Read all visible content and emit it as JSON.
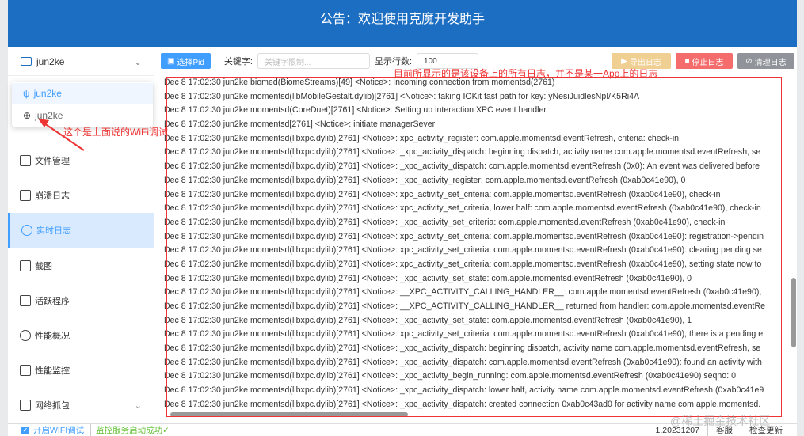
{
  "header": {
    "title": "公告：欢迎使用克魔开发助手"
  },
  "device_select": {
    "value": "jun2ke",
    "options": [
      {
        "label": "jun2ke",
        "type": "usb"
      },
      {
        "label": "jun2ke",
        "type": "wifi"
      }
    ]
  },
  "sidebar": {
    "items": [
      {
        "label": "文件管理"
      },
      {
        "label": "崩溃日志"
      },
      {
        "label": "实时日志",
        "active": true
      },
      {
        "label": "截图"
      },
      {
        "label": "活跃程序"
      },
      {
        "label": "性能概况"
      },
      {
        "label": "性能监控"
      },
      {
        "label": "网络抓包"
      }
    ]
  },
  "toolbar": {
    "select_pid": "选择Pid",
    "keyword_label": "关键字:",
    "keyword_placeholder": "关键字限制...",
    "rows_label": "显示行数:",
    "rows_value": "100",
    "export": "导出日志",
    "stop": "停止日志",
    "clear": "清理日志"
  },
  "colors": {
    "header": "#1b6ec2",
    "primary": "#409eff",
    "export": "#f0cf92",
    "stop": "#f56c6c",
    "clear": "#909399",
    "annotation": "#e33333"
  },
  "logs": [
    "Dec  8 17:02:30 jun2ke biomed(BiomeStreams)[49] <Notice>: Incoming connection from momentsd(2761)",
    "Dec  8 17:02:30 jun2ke momentsd(libMobileGestalt.dylib)[2761] <Notice>: taking IOKit fast path for key: yNesiJuidlesNpI/K5Ri4A",
    "Dec  8 17:02:30 jun2ke momentsd(CoreDuet)[2761] <Notice>: Setting up interaction XPC event handler",
    "Dec  8 17:02:30 jun2ke momentsd[2761] <Notice>: initiate managerSever",
    "Dec  8 17:02:30 jun2ke momentsd(libxpc.dylib)[2761] <Notice>: xpc_activity_register: com.apple.momentsd.eventRefresh, criteria: check-in",
    "Dec  8 17:02:30 jun2ke momentsd(libxpc.dylib)[2761] <Notice>: _xpc_activity_dispatch: beginning dispatch, activity name com.apple.momentsd.eventRefresh, se",
    "Dec  8 17:02:30 jun2ke momentsd(libxpc.dylib)[2761] <Notice>: _xpc_activity_dispatch: com.apple.momentsd.eventRefresh (0x0): An event was delivered before",
    "Dec  8 17:02:30 jun2ke momentsd(libxpc.dylib)[2761] <Notice>: _xpc_activity_register: com.apple.momentsd.eventRefresh (0xab0c41e90), 0",
    "Dec  8 17:02:30 jun2ke momentsd(libxpc.dylib)[2761] <Notice>: xpc_activity_set_criteria: com.apple.momentsd.eventRefresh (0xab0c41e90), check-in",
    "Dec  8 17:02:30 jun2ke momentsd(libxpc.dylib)[2761] <Notice>: xpc_activity_set_criteria, lower half: com.apple.momentsd.eventRefresh (0xab0c41e90), check-in",
    "Dec  8 17:02:30 jun2ke momentsd(libxpc.dylib)[2761] <Notice>: _xpc_activity_set_criteria: com.apple.momentsd.eventRefresh (0xab0c41e90), check-in",
    "Dec  8 17:02:30 jun2ke momentsd(libxpc.dylib)[2761] <Notice>: xpc_activity_set_criteria: com.apple.momentsd.eventRefresh (0xab0c41e90): registration->pendin",
    "Dec  8 17:02:30 jun2ke momentsd(libxpc.dylib)[2761] <Notice>: xpc_activity_set_criteria: com.apple.momentsd.eventRefresh (0xab0c41e90): clearing pending se",
    "Dec  8 17:02:30 jun2ke momentsd(libxpc.dylib)[2761] <Notice>: xpc_activity_set_criteria: com.apple.momentsd.eventRefresh (0xab0c41e90), setting state now to",
    "Dec  8 17:02:30 jun2ke momentsd(libxpc.dylib)[2761] <Notice>: _xpc_activity_set_state: com.apple.momentsd.eventRefresh (0xab0c41e90), 0",
    "Dec  8 17:02:30 jun2ke momentsd(libxpc.dylib)[2761] <Notice>: __XPC_ACTIVITY_CALLING_HANDLER__: com.apple.momentsd.eventRefresh (0xab0c41e90),",
    "Dec  8 17:02:30 jun2ke momentsd(libxpc.dylib)[2761] <Notice>: __XPC_ACTIVITY_CALLING_HANDLER__ returned from handler: com.apple.momentsd.eventRe",
    "Dec  8 17:02:30 jun2ke momentsd(libxpc.dylib)[2761] <Notice>: _xpc_activity_set_state: com.apple.momentsd.eventRefresh (0xab0c41e90), 1",
    "Dec  8 17:02:30 jun2ke momentsd(libxpc.dylib)[2761] <Notice>: xpc_activity_set_criteria: com.apple.momentsd.eventRefresh (0xab0c41e90), there is a pending e",
    "Dec  8 17:02:30 jun2ke momentsd(libxpc.dylib)[2761] <Notice>: _xpc_activity_dispatch: beginning dispatch, activity name com.apple.momentsd.eventRefresh, se",
    "Dec  8 17:02:30 jun2ke momentsd(libxpc.dylib)[2761] <Notice>: _xpc_activity_dispatch: com.apple.momentsd.eventRefresh (0xab0c41e90): found an activity with",
    "Dec  8 17:02:30 jun2ke momentsd(libxpc.dylib)[2761] <Notice>: _xpc_activity_begin_running: com.apple.momentsd.eventRefresh (0xab0c41e90) seqno: 0.",
    "Dec  8 17:02:30 jun2ke momentsd(libxpc.dylib)[2761] <Notice>: _xpc_activity_dispatch: lower half, activity name com.apple.momentsd.eventRefresh (0xab0c41e9",
    "Dec  8 17:02:30 jun2ke momentsd(libxpc.dylib)[2761] <Notice>: _xpc_activity_dispatch: created connection 0xab0c43ad0 for activity name com.apple.momentsd."
  ],
  "status": {
    "wifi_debug": "开启WIFI调试",
    "wifi_checked": true,
    "service": "监控服务启动成功✓",
    "version": "1.20231207",
    "support": "客服",
    "check_update": "检查更新"
  },
  "annotations": {
    "top": "目前所显示的是该设备上的所有日志，并不是某一App上的日志",
    "wifi": "这个是上面说的WiFi调试"
  },
  "watermark": "@稀土掘金技术社区"
}
